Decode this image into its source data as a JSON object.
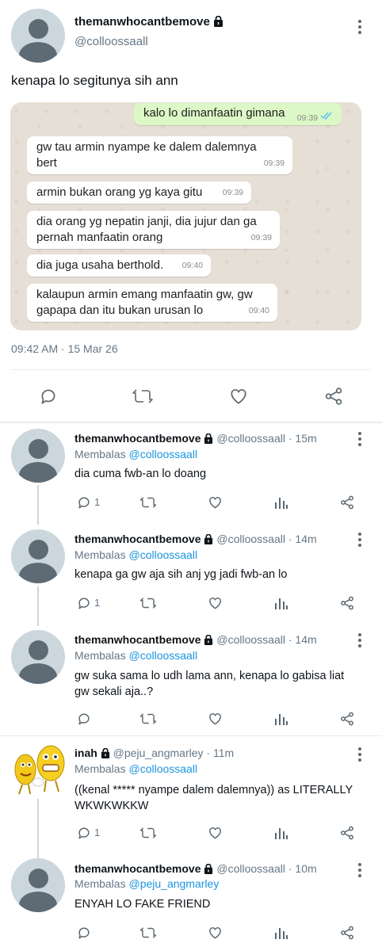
{
  "main_tweet": {
    "display_name": "themanwhocantbemove",
    "handle": "@colloossaall",
    "text": "kenapa lo segitunya sih ann",
    "timestamp": "09:42 AM · 15 Mar 26"
  },
  "chat": {
    "outgoing": {
      "text": "kalo lo dimanfaatin gimana",
      "time": "09:39"
    },
    "incoming": [
      {
        "line1": "gw tau armin nyampe ke dalem dalemnya",
        "line2": "bert",
        "time": "09:39"
      },
      {
        "line1": "armin bukan orang yg kaya gitu",
        "time": "09:39"
      },
      {
        "line1": "dia orang yg nepatin janji, dia jujur dan ga",
        "line2": "pernah manfaatin orang",
        "time": "09:39"
      },
      {
        "line1": "dia juga usaha berthold.",
        "time": "09:40"
      },
      {
        "line1": "kalaupun armin emang manfaatin gw, gw",
        "line2": "gapapa dan itu bukan urusan lo",
        "time": "09:40"
      }
    ]
  },
  "replies": [
    {
      "name": "themanwhocantbemove",
      "handle": "@colloossaall",
      "age": "15m",
      "replying_label": "Membalas",
      "replying_to": "@colloossaall",
      "line1": "dia cuma fwb-an lo doang",
      "line2": "",
      "reply_count": "1"
    },
    {
      "name": "themanwhocantbemove",
      "handle": "@colloossaall",
      "age": "14m",
      "replying_label": "Membalas",
      "replying_to": "@colloossaall",
      "line1": "kenapa ga gw aja sih anj yg jadi fwb-an lo",
      "line2": "",
      "reply_count": "1"
    },
    {
      "name": "themanwhocantbemove",
      "handle": "@colloossaall",
      "age": "14m",
      "replying_label": "Membalas",
      "replying_to": "@colloossaall",
      "line1": "gw suka sama lo udh lama ann, kenapa lo gabisa liat",
      "line2": "gw sekali aja..?",
      "reply_count": ""
    },
    {
      "name": "inah",
      "handle": "@peju_angmarley",
      "age": "11m",
      "replying_label": "Membalas",
      "replying_to": "@colloossaall",
      "line1": "((kenal ***** nyampe dalem dalemnya)) as LITERALLY",
      "line2": "WKWKWKKW",
      "reply_count": "1"
    },
    {
      "name": "themanwhocantbemove",
      "handle": "@colloossaall",
      "age": "10m",
      "replying_label": "Membalas",
      "replying_to": "@peju_angmarley",
      "line1": "ENYAH LO FAKE FRIEND",
      "line2": "",
      "reply_count": ""
    }
  ],
  "icons": {
    "reply": "reply-icon",
    "retweet": "retweet-icon",
    "like": "heart-icon",
    "analytics": "analytics-icon",
    "share": "share-icon",
    "more": "more-icon",
    "lock": "lock-icon"
  },
  "colors": {
    "accent": "#1b95e0",
    "muted": "#657786",
    "chat_bg": "#e6dfd6",
    "outgoing_bubble": "#dcf8c6",
    "read_ticks": "#4fc3f7"
  }
}
